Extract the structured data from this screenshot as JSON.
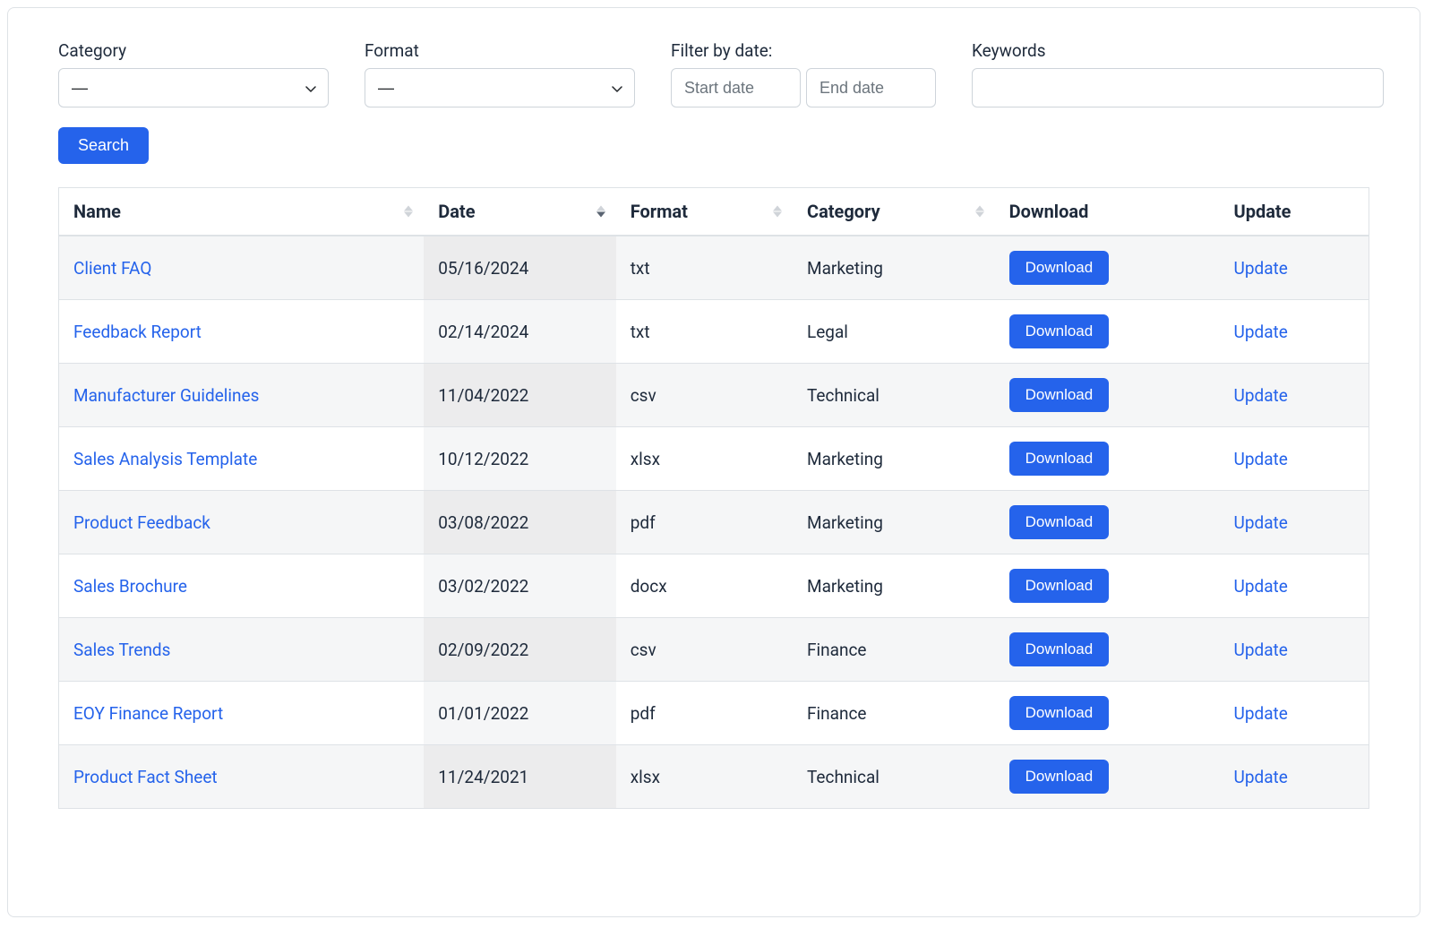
{
  "filters": {
    "category": {
      "label": "Category",
      "value": "—"
    },
    "format": {
      "label": "Format",
      "value": "—"
    },
    "date": {
      "label": "Filter by date:",
      "start_placeholder": "Start date",
      "end_placeholder": "End date"
    },
    "keywords": {
      "label": "Keywords",
      "value": ""
    },
    "search_button": "Search"
  },
  "table": {
    "headers": {
      "name": "Name",
      "date": "Date",
      "format": "Format",
      "category": "Category",
      "download": "Download",
      "update": "Update"
    },
    "download_button": "Download",
    "update_link": "Update",
    "rows": [
      {
        "name": "Client FAQ",
        "date": "05/16/2024",
        "format": "txt",
        "category": "Marketing"
      },
      {
        "name": "Feedback Report",
        "date": "02/14/2024",
        "format": "txt",
        "category": "Legal"
      },
      {
        "name": "Manufacturer Guidelines",
        "date": "11/04/2022",
        "format": "csv",
        "category": "Technical"
      },
      {
        "name": "Sales Analysis Template",
        "date": "10/12/2022",
        "format": "xlsx",
        "category": "Marketing"
      },
      {
        "name": "Product Feedback",
        "date": "03/08/2022",
        "format": "pdf",
        "category": "Marketing"
      },
      {
        "name": "Sales Brochure",
        "date": "03/02/2022",
        "format": "docx",
        "category": "Marketing"
      },
      {
        "name": "Sales Trends",
        "date": "02/09/2022",
        "format": "csv",
        "category": "Finance"
      },
      {
        "name": "EOY Finance Report",
        "date": "01/01/2022",
        "format": "pdf",
        "category": "Finance"
      },
      {
        "name": "Product Fact Sheet",
        "date": "11/24/2021",
        "format": "xlsx",
        "category": "Technical"
      }
    ]
  }
}
